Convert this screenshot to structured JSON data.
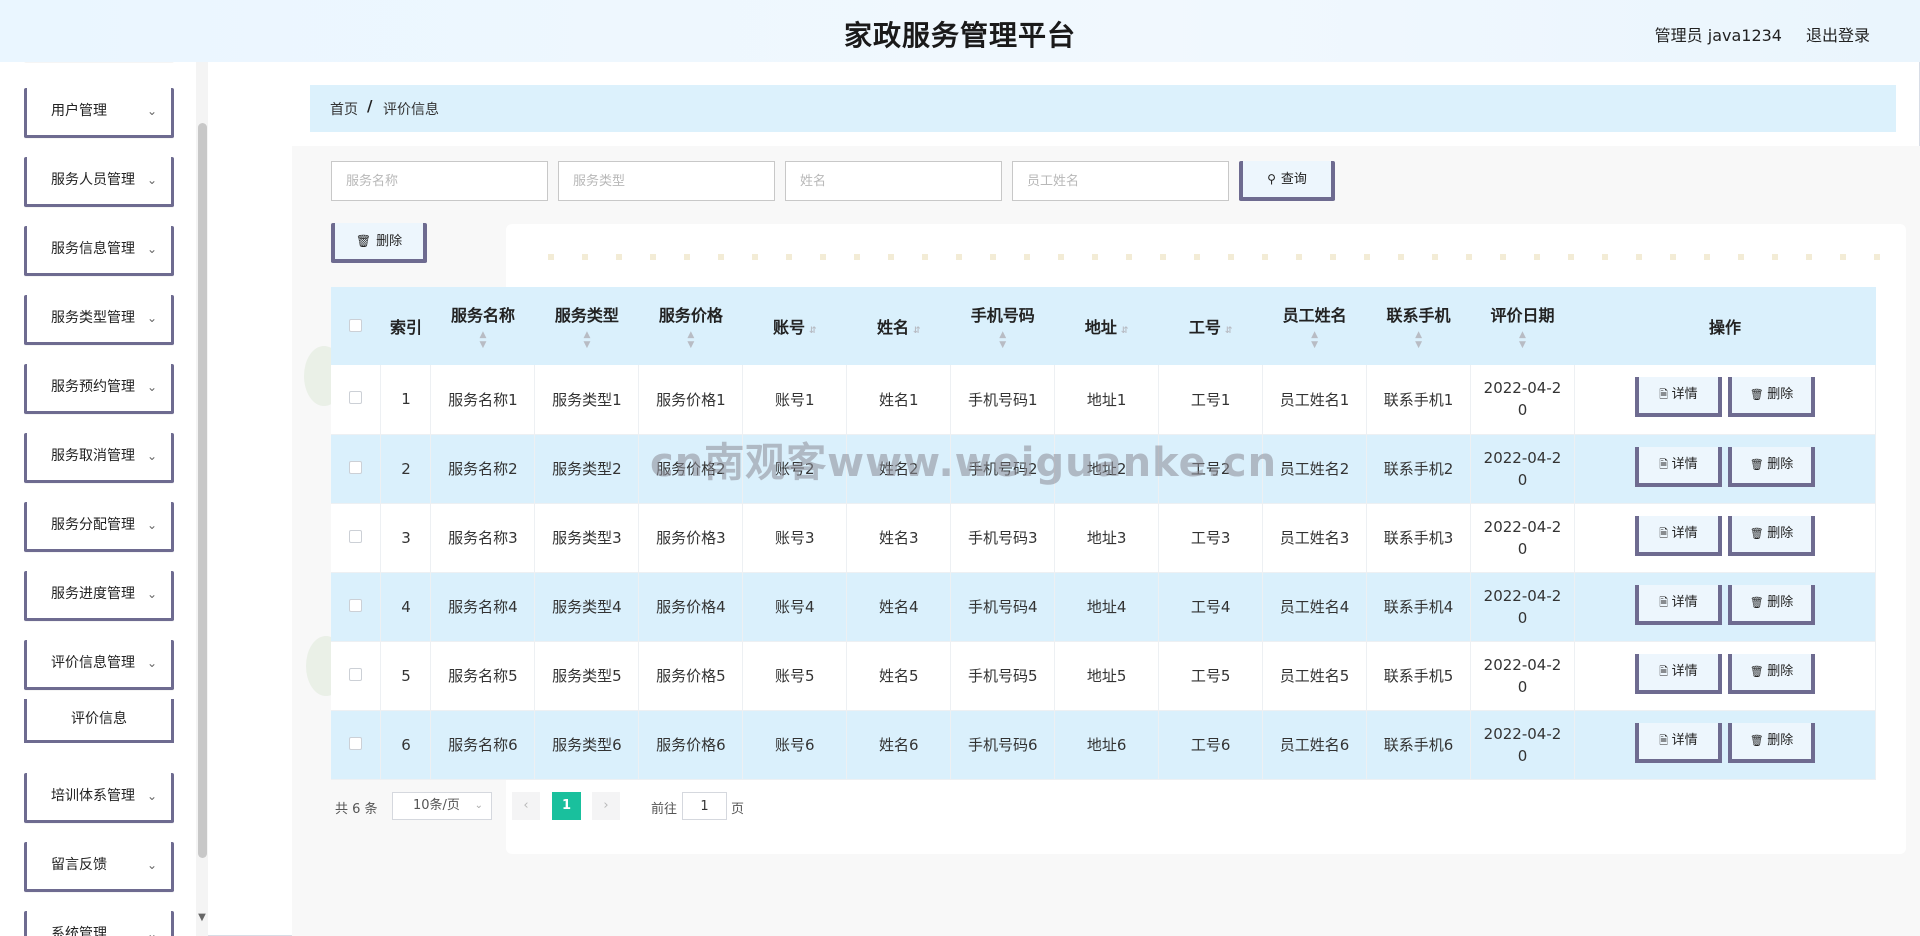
{
  "header": {
    "title": "家政服务管理平台",
    "user": "管理员 java1234",
    "logout": "退出登录"
  },
  "sidebar": {
    "items": [
      {
        "label": "用户管理"
      },
      {
        "label": "服务人员管理"
      },
      {
        "label": "服务信息管理"
      },
      {
        "label": "服务类型管理"
      },
      {
        "label": "服务预约管理"
      },
      {
        "label": "服务取消管理"
      },
      {
        "label": "服务分配管理"
      },
      {
        "label": "服务进度管理"
      },
      {
        "label": "评价信息管理"
      },
      {
        "label": "培训体系管理"
      },
      {
        "label": "留言反馈"
      },
      {
        "label": "系统管理"
      }
    ],
    "sub_item": "评价信息"
  },
  "breadcrumb": {
    "home": "首页",
    "separator": "/",
    "current": "评价信息"
  },
  "search": {
    "service_name_placeholder": "服务名称",
    "service_type_placeholder": "服务类型",
    "name_placeholder": "姓名",
    "staff_name_placeholder": "员工姓名",
    "query_label": "查询"
  },
  "toolbar": {
    "delete_label": "删除"
  },
  "table": {
    "headers": {
      "index": "索引",
      "service_name": "服务名称",
      "service_type": "服务类型",
      "service_price": "服务价格",
      "account": "账号",
      "name": "姓名",
      "phone": "手机号码",
      "address": "地址",
      "staff_no": "工号",
      "staff_name": "员工姓名",
      "contact_phone": "联系手机",
      "review_date": "评价日期",
      "actions": "操作"
    },
    "detail_label": "详情",
    "delete_label": "删除",
    "rows": [
      {
        "index": "1",
        "service_name": "服务名称1",
        "service_type": "服务类型1",
        "service_price": "服务价格1",
        "account": "账号1",
        "name": "姓名1",
        "phone": "手机号码1",
        "address": "地址1",
        "staff_no": "工号1",
        "staff_name": "员工姓名1",
        "contact_phone": "联系手机1",
        "review_date": "2022-04-20"
      },
      {
        "index": "2",
        "service_name": "服务名称2",
        "service_type": "服务类型2",
        "service_price": "服务价格2",
        "account": "账号2",
        "name": "姓名2",
        "phone": "手机号码2",
        "address": "地址2",
        "staff_no": "工号2",
        "staff_name": "员工姓名2",
        "contact_phone": "联系手机2",
        "review_date": "2022-04-20"
      },
      {
        "index": "3",
        "service_name": "服务名称3",
        "service_type": "服务类型3",
        "service_price": "服务价格3",
        "account": "账号3",
        "name": "姓名3",
        "phone": "手机号码3",
        "address": "地址3",
        "staff_no": "工号3",
        "staff_name": "员工姓名3",
        "contact_phone": "联系手机3",
        "review_date": "2022-04-20"
      },
      {
        "index": "4",
        "service_name": "服务名称4",
        "service_type": "服务类型4",
        "service_price": "服务价格4",
        "account": "账号4",
        "name": "姓名4",
        "phone": "手机号码4",
        "address": "地址4",
        "staff_no": "工号4",
        "staff_name": "员工姓名4",
        "contact_phone": "联系手机4",
        "review_date": "2022-04-20"
      },
      {
        "index": "5",
        "service_name": "服务名称5",
        "service_type": "服务类型5",
        "service_price": "服务价格5",
        "account": "账号5",
        "name": "姓名5",
        "phone": "手机号码5",
        "address": "地址5",
        "staff_no": "工号5",
        "staff_name": "员工姓名5",
        "contact_phone": "联系手机5",
        "review_date": "2022-04-20"
      },
      {
        "index": "6",
        "service_name": "服务名称6",
        "service_type": "服务类型6",
        "service_price": "服务价格6",
        "account": "账号6",
        "name": "姓名6",
        "phone": "手机号码6",
        "address": "地址6",
        "staff_no": "工号6",
        "staff_name": "员工姓名6",
        "contact_phone": "联系手机6",
        "review_date": "2022-04-20"
      }
    ]
  },
  "pagination": {
    "total": "共 6 条",
    "page_size": "10条/页",
    "current_page": "1",
    "goto_label": "前往",
    "goto_value": "1",
    "page_suffix": "页"
  },
  "watermark": "cn南观客www.weiguanke.cn",
  "colors": {
    "accent_green": "#19c09d",
    "row_highlight": "#daf0fc",
    "button_border": "#6e6b90"
  }
}
